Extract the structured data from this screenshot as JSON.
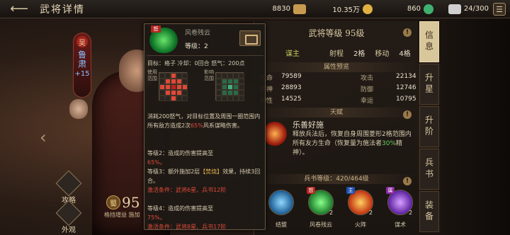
{
  "header": {
    "title": "武将详情",
    "back_arrow": "⟵",
    "resources": [
      {
        "value": "8830",
        "icon": "coin-stack-icon",
        "color": "#c89a50"
      },
      {
        "value": "10.35万",
        "icon": "gold-coin-icon",
        "color": "#e0b040"
      },
      {
        "value": "860",
        "icon": "jade-icon",
        "color": "#40b070"
      },
      {
        "value": "24/300",
        "icon": "stamina-icon",
        "color": "#d0d0d0"
      }
    ],
    "menu_glyph": "☰"
  },
  "hero": {
    "faction": "吴",
    "name": "鲁肃",
    "bonus": "+15",
    "stars": "★★★★",
    "level_icon_glyph": "蜀",
    "level": "95",
    "note": "格挡增益 施加"
  },
  "side_buttons": [
    {
      "label": "攻略"
    },
    {
      "label": "外观"
    }
  ],
  "panel": {
    "title": "武将等级 95级",
    "role": "谋主",
    "range_label": "射程",
    "range_value": "2格",
    "move_label": "移动",
    "move_value": "4格",
    "attr_header": "属性预览",
    "stats": [
      {
        "k": "生命",
        "v": "79589",
        "k2": "攻击",
        "v2": "22134"
      },
      {
        "k": "精神",
        "v": "28893",
        "k2": "防御",
        "v2": "12746"
      },
      {
        "k": "韧性",
        "v": "14525",
        "k2": "幸运",
        "v2": "10795"
      }
    ],
    "talent_header": "天赋",
    "talent_name": "乐善好施",
    "talent_desc_1": "释放兵法后，恢复自身周围菱形2格范围内所有友方生命（恢复量为施法者",
    "talent_desc_hl": "30%",
    "talent_desc_2": "精神）。",
    "book_header": "兵书等级：420/464级",
    "skills": [
      {
        "label": "结盟",
        "tag": "",
        "level": "",
        "color": "#3a9ad0"
      },
      {
        "label": "风卷残云",
        "tag": "怒",
        "level": "2",
        "color": "#28a040"
      },
      {
        "label": "火阵",
        "tag": "主",
        "level": "2",
        "color": "#e05020"
      },
      {
        "label": "谋术",
        "tag": "属",
        "level": "2",
        "color": "#8040c0"
      }
    ]
  },
  "tabs": [
    {
      "label": "信息",
      "active": true
    },
    {
      "label": "升星",
      "active": false
    },
    {
      "label": "升阶",
      "active": false
    },
    {
      "label": "兵书",
      "active": false
    },
    {
      "label": "装备",
      "active": false
    }
  ],
  "tooltip": {
    "tag": "怒",
    "name": "风卷残云",
    "level": "等级：2",
    "target_line": "目标：格子  冷却：0回合  怒气：200点",
    "use_range_label": "使用范围",
    "effect_range_label": "影响范围",
    "desc_1a": "消耗200怒气，对目标位置及周围一圈范围内所有敌方造成2次",
    "desc_1b": "65%",
    "desc_1c": "风系谋略伤害。",
    "lv2": "等级2：造成的伤害提高至",
    "lv2_val": "65%。",
    "lv3a": "等级3：额外施加2层",
    "lv3_burn": "【焚烧】",
    "lv3b": "效果，持续3回合。",
    "lv3_req": "激活条件：武将6星、兵书12阶",
    "lv4": "等级4：造成的伤害提高至",
    "lv4_val": "75%。",
    "lv4_req": "激活条件：武将8星、兵书17阶"
  }
}
